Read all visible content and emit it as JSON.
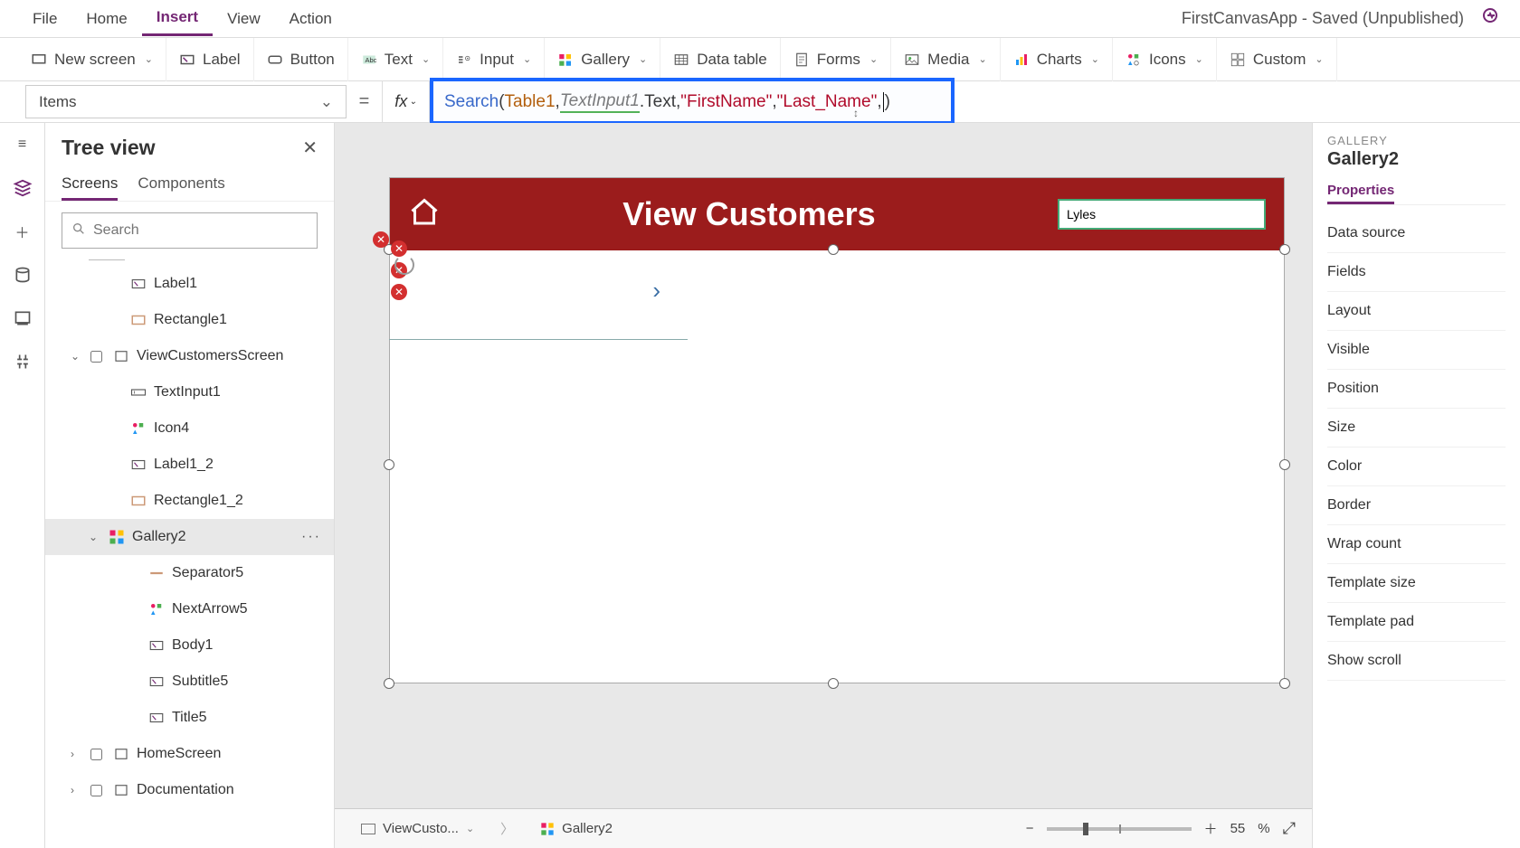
{
  "menubar": {
    "items": [
      "File",
      "Home",
      "Insert",
      "View",
      "Action"
    ],
    "active_index": 2,
    "app_title": "FirstCanvasApp - Saved (Unpublished)"
  },
  "ribbon": {
    "new_screen": "New screen",
    "label": "Label",
    "button": "Button",
    "text": "Text",
    "input": "Input",
    "gallery": "Gallery",
    "data_table": "Data table",
    "forms": "Forms",
    "media": "Media",
    "charts": "Charts",
    "icons": "Icons",
    "custom": "Custom"
  },
  "formula": {
    "property": "Items",
    "equals": "=",
    "fx": "fx",
    "tokens": {
      "fn": "Search",
      "open": "(",
      "table": "Table1",
      "c1": ", ",
      "input_ref": "TextInput1",
      "dot_text": ".Text",
      "c2": ", ",
      "col1": "\"FirstName\"",
      "c3": ", ",
      "col2": "\"Last_Name\"",
      "c4": ", ",
      "close": ")"
    },
    "resize_hint": "↕"
  },
  "tree": {
    "title": "Tree view",
    "tabs": [
      "Screens",
      "Components"
    ],
    "active_tab": 0,
    "search_placeholder": "Search",
    "nodes": [
      {
        "label": "Label1",
        "icon": "label-icon",
        "indent": 2
      },
      {
        "label": "Rectangle1",
        "icon": "rectangle-icon",
        "indent": 2
      },
      {
        "label": "ViewCustomersScreen",
        "icon": "screen-icon",
        "indent": 0,
        "expander": "⌄"
      },
      {
        "label": "TextInput1",
        "icon": "textinput-icon",
        "indent": 2
      },
      {
        "label": "Icon4",
        "icon": "icon-icon",
        "indent": 2
      },
      {
        "label": "Label1_2",
        "icon": "label-icon",
        "indent": 2
      },
      {
        "label": "Rectangle1_2",
        "icon": "rectangle-icon",
        "indent": 2
      },
      {
        "label": "Gallery2",
        "icon": "gallery-icon",
        "indent": 1,
        "selected": true,
        "expander": "⌄",
        "more": "···"
      },
      {
        "label": "Separator5",
        "icon": "separator-icon",
        "indent": 3
      },
      {
        "label": "NextArrow5",
        "icon": "icon-icon",
        "indent": 3
      },
      {
        "label": "Body1",
        "icon": "label-icon",
        "indent": 3
      },
      {
        "label": "Subtitle5",
        "icon": "label-icon",
        "indent": 3
      },
      {
        "label": "Title5",
        "icon": "label-icon",
        "indent": 3
      },
      {
        "label": "HomeScreen",
        "icon": "screen-icon",
        "indent": 0,
        "expander": "›"
      },
      {
        "label": "Documentation",
        "icon": "screen-icon",
        "indent": 0,
        "expander": "›"
      }
    ]
  },
  "canvas": {
    "app_title": "View Customers",
    "search_value": "Lyles",
    "next_arrow": "›"
  },
  "footer": {
    "crumb1": "ViewCusto...",
    "crumb2": "Gallery2",
    "zoom_value": "55",
    "zoom_pct": "%"
  },
  "properties": {
    "category": "GALLERY",
    "control_name": "Gallery2",
    "tabs": [
      "Properties"
    ],
    "rows": [
      "Data source",
      "Fields",
      "Layout",
      "Visible",
      "Position",
      "Size",
      "Color",
      "Border",
      "Wrap count",
      "Template size",
      "Template pad",
      "Show scroll"
    ]
  },
  "icons": {
    "search": "🔍",
    "close": "✕",
    "hamburger": "≡",
    "layers": "❐",
    "plus": "＋",
    "db": "🗄",
    "tools": "⚙",
    "screen": "☐",
    "minus": "−",
    "expand": "⤢"
  }
}
